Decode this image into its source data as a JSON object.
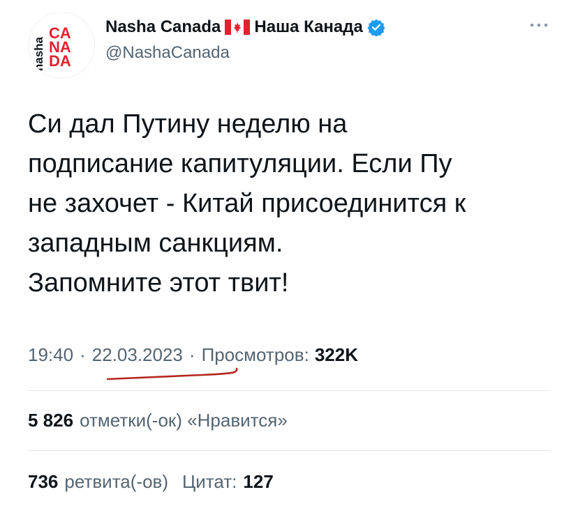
{
  "author": {
    "avatar_text_top": "CA",
    "avatar_text_mid": "NA",
    "avatar_text_bottom": "DA",
    "avatar_text_side": "nasha",
    "display_name_latin": "Nasha Canada",
    "display_name_cyrillic": "Наша Канада",
    "handle": "@NashaCanada",
    "flag_icon": "canada-flag-icon",
    "verified_icon": "verified-badge-icon",
    "more_icon": "more-options-icon"
  },
  "tweet": {
    "lines": [
      "Си дал Путину неделю на",
      "подписание капитуляции. Если Пу",
      "не захочет - Китай присоединится к",
      "западным санкциям.",
      "Запомните этот твит!"
    ]
  },
  "meta": {
    "time": "19:40",
    "separator": "·",
    "date": "22.03.2023",
    "views_label": "Просмотров:",
    "views_count": "322K"
  },
  "stats": {
    "likes_count": "5 826",
    "likes_label": "отметки(-ок) «Нравится»",
    "retweets_count": "736",
    "retweets_label": "ретвита(-ов)",
    "quotes_label": "Цитат:",
    "quotes_count": "127"
  },
  "colors": {
    "text": "#0f1419",
    "secondary": "#536471",
    "verified": "#1d9bf0",
    "brand_red": "#e4202e",
    "underline_red": "#b3261e",
    "divider": "#e1e6ea"
  }
}
